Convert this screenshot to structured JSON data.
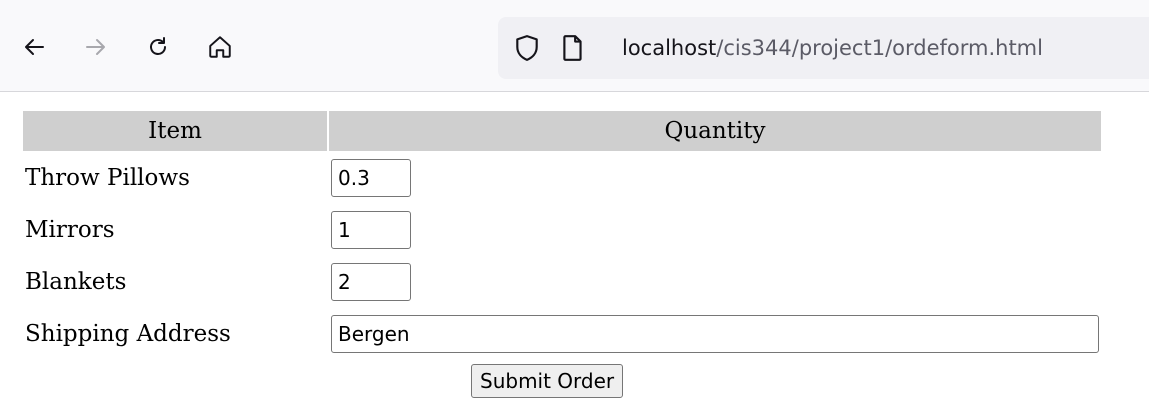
{
  "browser": {
    "url_host": "localhost",
    "url_path": "/cis344/project1/ordeform.html",
    "icons": [
      "back-arrow-icon",
      "forward-arrow-icon",
      "reload-icon",
      "home-icon",
      "shield-icon",
      "page-icon"
    ]
  },
  "form": {
    "headers": {
      "item": "Item",
      "quantity": "Quantity"
    },
    "rows": [
      {
        "label": "Throw Pillows",
        "value": "0.3"
      },
      {
        "label": "Mirrors",
        "value": "1"
      },
      {
        "label": "Blankets",
        "value": "2"
      }
    ],
    "shipping": {
      "label": "Shipping Address",
      "value": "Bergen"
    },
    "submit_label": "Submit Order"
  }
}
